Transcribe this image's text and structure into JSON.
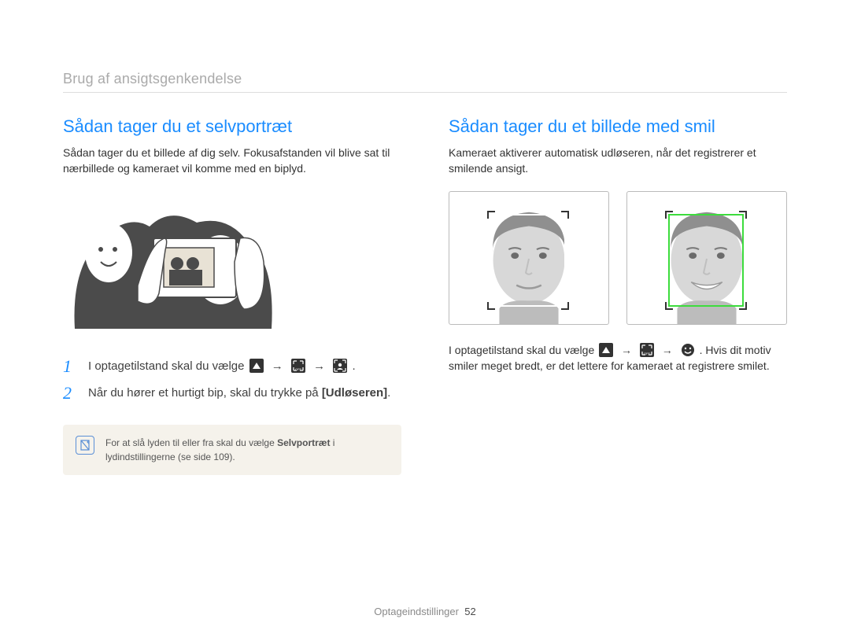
{
  "breadcrumb": "Brug af ansigtsgenkendelse",
  "left": {
    "heading": "Sådan tager du et selvportræt",
    "intro": "Sådan tager du et billede af dig selv. Fokusafstanden vil blive sat til nærbillede og kameraet vil komme med en biplyd.",
    "step1_prefix": "I optagetilstand skal du vælge ",
    "step1_suffix": ".",
    "step2_prefix": "Når du hører et hurtigt bip, skal du trykke på ",
    "step2_bold": "[Udløseren]",
    "step2_suffix": ".",
    "note_prefix": "For at slå lyden til eller fra skal du vælge ",
    "note_bold": "Selvportræt",
    "note_suffix": " i lydindstillingerne (se side 109)."
  },
  "right": {
    "heading": "Sådan tager du et billede med smil",
    "intro": "Kameraet aktiverer automatisk udløseren, når det registrerer et smilende ansigt.",
    "para_prefix": "I optagetilstand skal du vælge ",
    "para_suffix": ". Hvis dit motiv smiler meget bredt, er det lettere for kameraet at registrere smilet."
  },
  "icons": {
    "up_triangle": "up-triangle-icon",
    "face_off": "face-off-icon",
    "face_self": "face-self-icon",
    "smile": "smile-icon",
    "arrow": "→"
  },
  "footer": {
    "label": "Optageindstillinger",
    "page": "52"
  },
  "nums": {
    "one": "1",
    "two": "2"
  }
}
